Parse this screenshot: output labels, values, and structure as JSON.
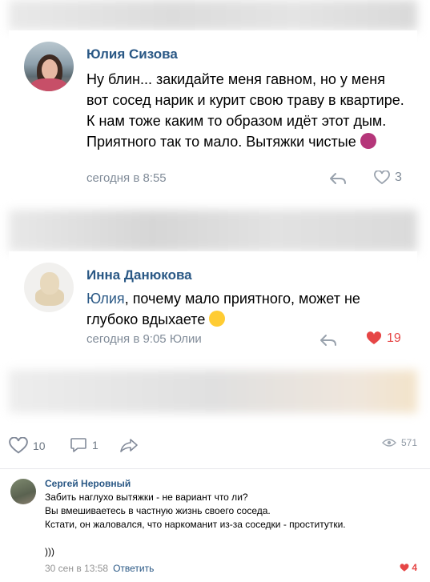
{
  "comments": [
    {
      "author": "Юлия Сизова",
      "text": "Ну блин... закидайте меня гавном, но у меня вот сосед нарик и курит свою траву в квартире. К нам тоже каким то образом идёт этот дым. Приятного так то мало. Вытяжки чистые",
      "emoji": "woman-shrugging-icon",
      "time": "сегодня в 8:55",
      "likes": "3",
      "liked": false
    },
    {
      "author": "Инна Данюкова",
      "mention": "Юлия",
      "text": ", почему мало приятного, может не глубоко вдыхаете",
      "emoji": "laughing-face-icon",
      "time": "сегодня в 9:05 Юлии",
      "likes": "19",
      "liked": true
    }
  ],
  "post_actions": {
    "likes": "10",
    "comments": "1",
    "views": "571"
  },
  "bottom_comment": {
    "author": "Сергей Неровный",
    "lines": [
      "Забить наглухо вытяжки - не вариант что ли?",
      "Вы вмешиваетесь в частную жизнь своего соседа.",
      "Кстати, он жаловался, что наркоманит из-за соседки - проститутки.",
      "",
      ")))"
    ],
    "date": "30 сен в 13:58",
    "reply_label": "Ответить",
    "likes": "4"
  },
  "colors": {
    "link": "#2a5885",
    "meta": "#818c99",
    "like_active": "#e64646"
  }
}
